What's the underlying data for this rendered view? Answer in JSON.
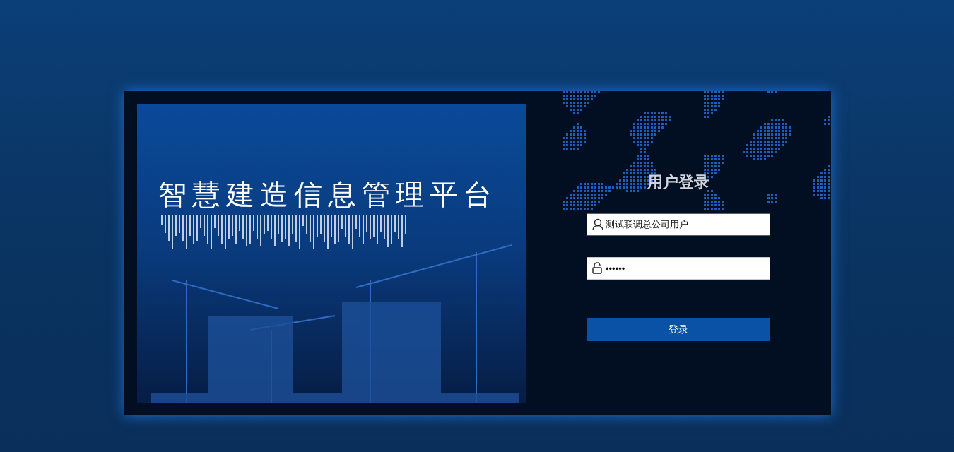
{
  "banner": {
    "title": "智慧建造信息管理平台"
  },
  "login": {
    "heading": "用户登录",
    "username": {
      "value": "测试联调总公司用户",
      "focused": true
    },
    "password": {
      "value": "••••••",
      "focused": false
    },
    "submit": "登录"
  }
}
